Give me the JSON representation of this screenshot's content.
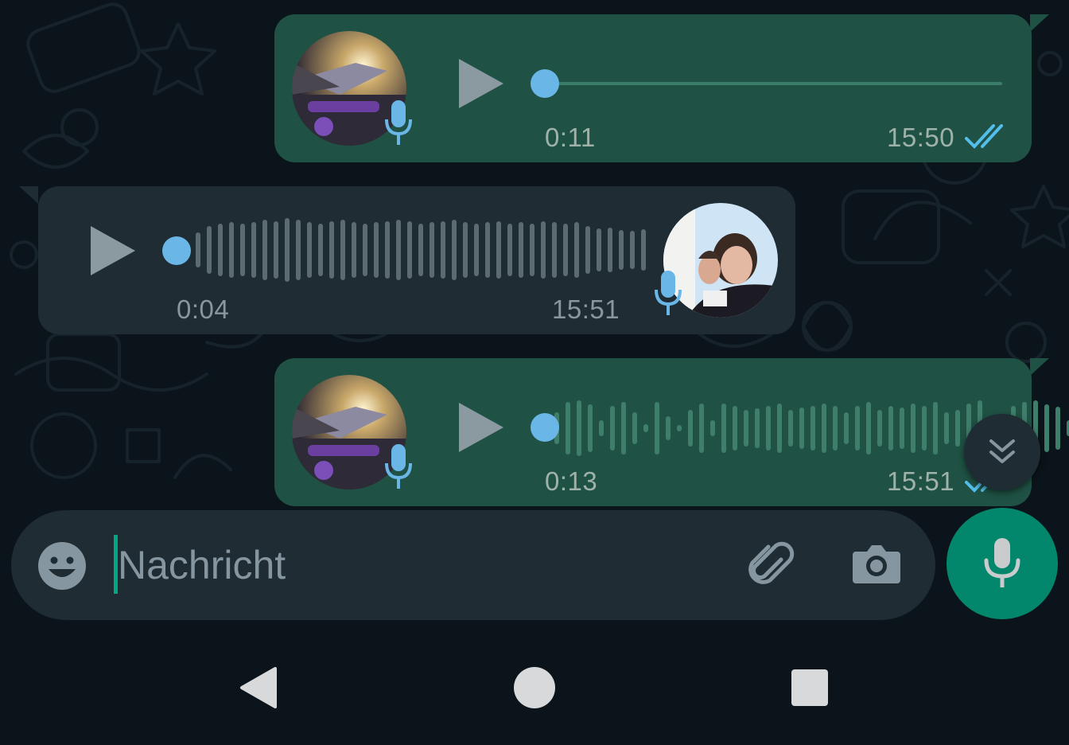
{
  "messages": [
    {
      "direction": "outgoing",
      "duration": "0:11",
      "time": "15:50",
      "status": "read",
      "progress": 0,
      "waveform": "flat"
    },
    {
      "direction": "incoming",
      "duration": "0:04",
      "time": "15:51",
      "progress": 0,
      "waveform": "bars"
    },
    {
      "direction": "outgoing",
      "duration": "0:13",
      "time": "15:51",
      "status": "read",
      "progress": 0,
      "waveform": "bars"
    }
  ],
  "composer": {
    "placeholder": "Nachricht",
    "icons": [
      "emoji-icon",
      "attach-icon",
      "camera-icon",
      "mic-icon"
    ]
  },
  "scroll_fab": {
    "icon": "double-chevron-down-icon"
  },
  "navigation": {
    "icons": [
      "back-triangle-icon",
      "home-circle-icon",
      "recents-square-icon"
    ]
  },
  "colors": {
    "background": "#0b141a",
    "outgoing_bubble": "#1f5244",
    "incoming_bubble": "#1f2c34",
    "accent": "#00a884",
    "voice_dot": "#6ab6e7",
    "read_ticks": "#53bdeb"
  }
}
